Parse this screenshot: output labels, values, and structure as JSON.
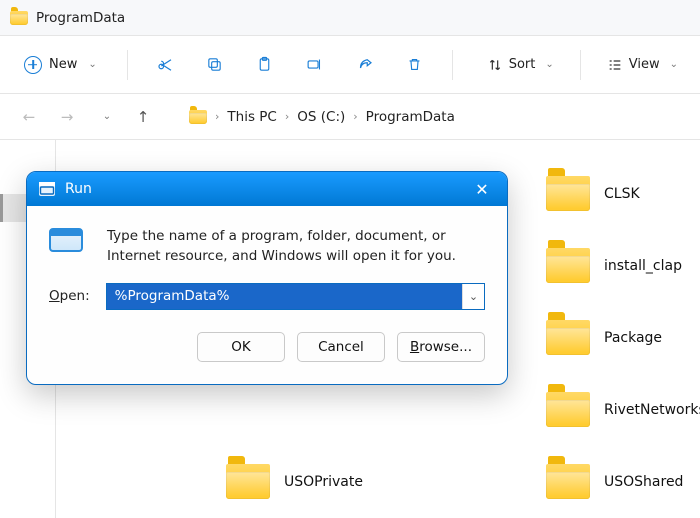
{
  "title_bar": {
    "folder_name": "ProgramData"
  },
  "toolbar": {
    "new_label": "New",
    "sort_label": "Sort",
    "view_label": "View"
  },
  "breadcrumb": {
    "items": [
      "This PC",
      "OS (C:)",
      "ProgramData"
    ]
  },
  "folders": {
    "clsk": "CLSK",
    "install_clap": "install_clap",
    "package": "Package",
    "rivetnetworks": "RivetNetworks",
    "usoprivate": "USOPrivate",
    "usoshared": "USOShared"
  },
  "run_dialog": {
    "title": "Run",
    "description": "Type the name of a program, folder, document, or Internet resource, and Windows will open it for you.",
    "open_label_pre": "O",
    "open_label_post": "pen:",
    "value": "%ProgramData%",
    "ok": "OK",
    "cancel": "Cancel",
    "browse_pre": "B",
    "browse_post": "rowse..."
  }
}
